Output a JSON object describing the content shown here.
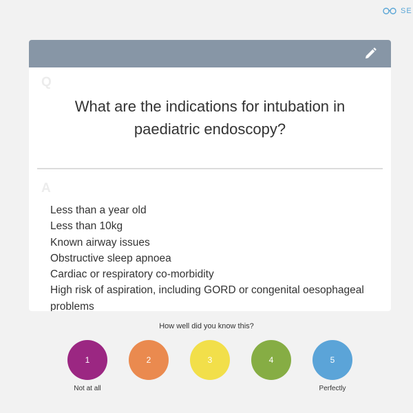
{
  "header": {
    "see_label": "SE",
    "see_icon": "glasses-icon",
    "accent_color": "#5aa6d6"
  },
  "card": {
    "header_color": "#8796a6",
    "edit_icon": "pencil-icon",
    "question_marker": "Q",
    "question": "What are the indications for intubation in paediatric endoscopy?",
    "answer_marker": "A",
    "answer_items": [
      "Less than a year old",
      "Less than 10kg",
      "Known airway issues",
      "Obstructive sleep apnoea",
      "Cardiac or respiratory co-morbidity",
      "High risk of aspiration, including GORD or congenital oesophageal problems"
    ]
  },
  "rating": {
    "prompt": "How well did you know this?",
    "buttons": [
      {
        "label": "1",
        "color": "#9b2782"
      },
      {
        "label": "2",
        "color": "#ea8a4f"
      },
      {
        "label": "3",
        "color": "#f2df4a"
      },
      {
        "label": "4",
        "color": "#86ad44"
      },
      {
        "label": "5",
        "color": "#5ba4d8"
      }
    ],
    "low_caption": "Not at all",
    "high_caption": "Perfectly"
  }
}
